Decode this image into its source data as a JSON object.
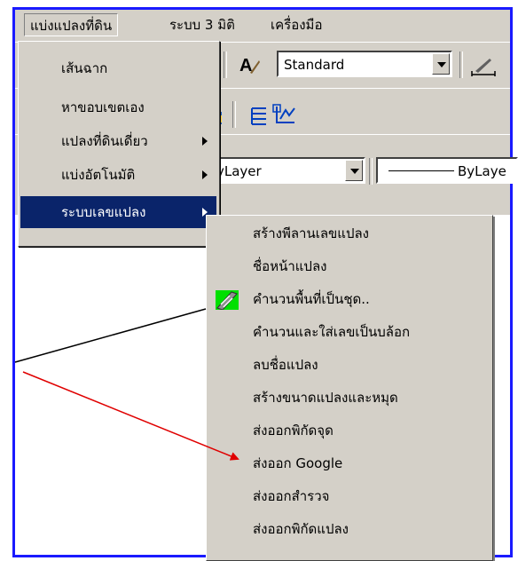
{
  "menubar": {
    "items": [
      {
        "label": "แบ่งแปลงที่ดิน",
        "active": true
      },
      {
        "label": "ระบบ 3 มิติ"
      },
      {
        "label": "เครื่องมือ"
      }
    ]
  },
  "toolbar": {
    "text_style": "Standard",
    "layer_combo": "yLayer",
    "linetype_combo": "ByLaye"
  },
  "menu_main": {
    "items": [
      {
        "label": "เส้นฉาก"
      },
      {
        "label": "หาขอบเขตเอง"
      },
      {
        "label": "แปลงที่ดินเดี่ยว"
      },
      {
        "label": "แบ่งอัตโนมัติ"
      },
      {
        "label": "ระบบเลขแปลง"
      }
    ]
  },
  "submenu": {
    "items": [
      {
        "label": "สร้างพีลานเลขแปลง"
      },
      {
        "label": "ชื่อหน้าแปลง"
      },
      {
        "label": "คำนวนพื้นที่เป็นชุด.."
      },
      {
        "label": "คำนวนและใส่เลขเป็นบล้อก"
      },
      {
        "label": "ลบชื่อแปลง"
      },
      {
        "label": "สร้างขนาดแปลงและหมุด"
      },
      {
        "label": "ส่งออกพิกัดจุด"
      },
      {
        "label": "ส่งออก Google"
      },
      {
        "label": "ส่งออกสำรวจ"
      },
      {
        "label": "ส่งออกพิกัดแปลง"
      }
    ]
  },
  "colors": {
    "frame": "#1a1aff",
    "menu_bg": "#d4d0c8",
    "selection": "#0a246a",
    "arrow": "#e00000"
  },
  "icons": {
    "area_batch": "area-calc-icon",
    "text_style": "text-style-icon",
    "dimension": "dimension-icon"
  }
}
